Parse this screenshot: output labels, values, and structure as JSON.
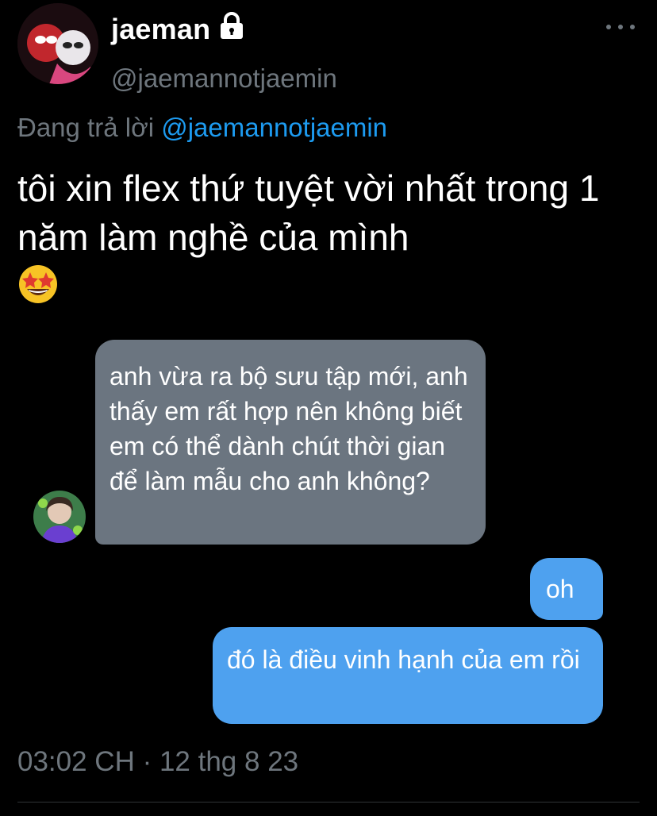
{
  "author": {
    "display_name": "jaeman",
    "handle": "@jaemannotjaemin"
  },
  "reply_context": {
    "prefix": "Đang trả lời",
    "mention": "@jaemannotjaemin"
  },
  "tweet": {
    "text": "tôi xin flex thứ tuyệt vời nhất trong 1 năm làm nghề của mình"
  },
  "chat": {
    "received_message": "anh vừa ra bộ sưu tập mới, anh thấy em rất hợp nên không biết em có thể dành chút thời gian để làm mẫu cho anh không?",
    "sent_messages": [
      "oh",
      "đó là điều vinh hạnh của em rồi"
    ]
  },
  "timestamp": "03:02 CH · 12 thg 8 23",
  "colors": {
    "background": "#000000",
    "muted_text": "#6e767d",
    "link_blue": "#1d9bf0",
    "received_bubble": "#6b7580",
    "sent_bubble": "#4ea1ef"
  }
}
